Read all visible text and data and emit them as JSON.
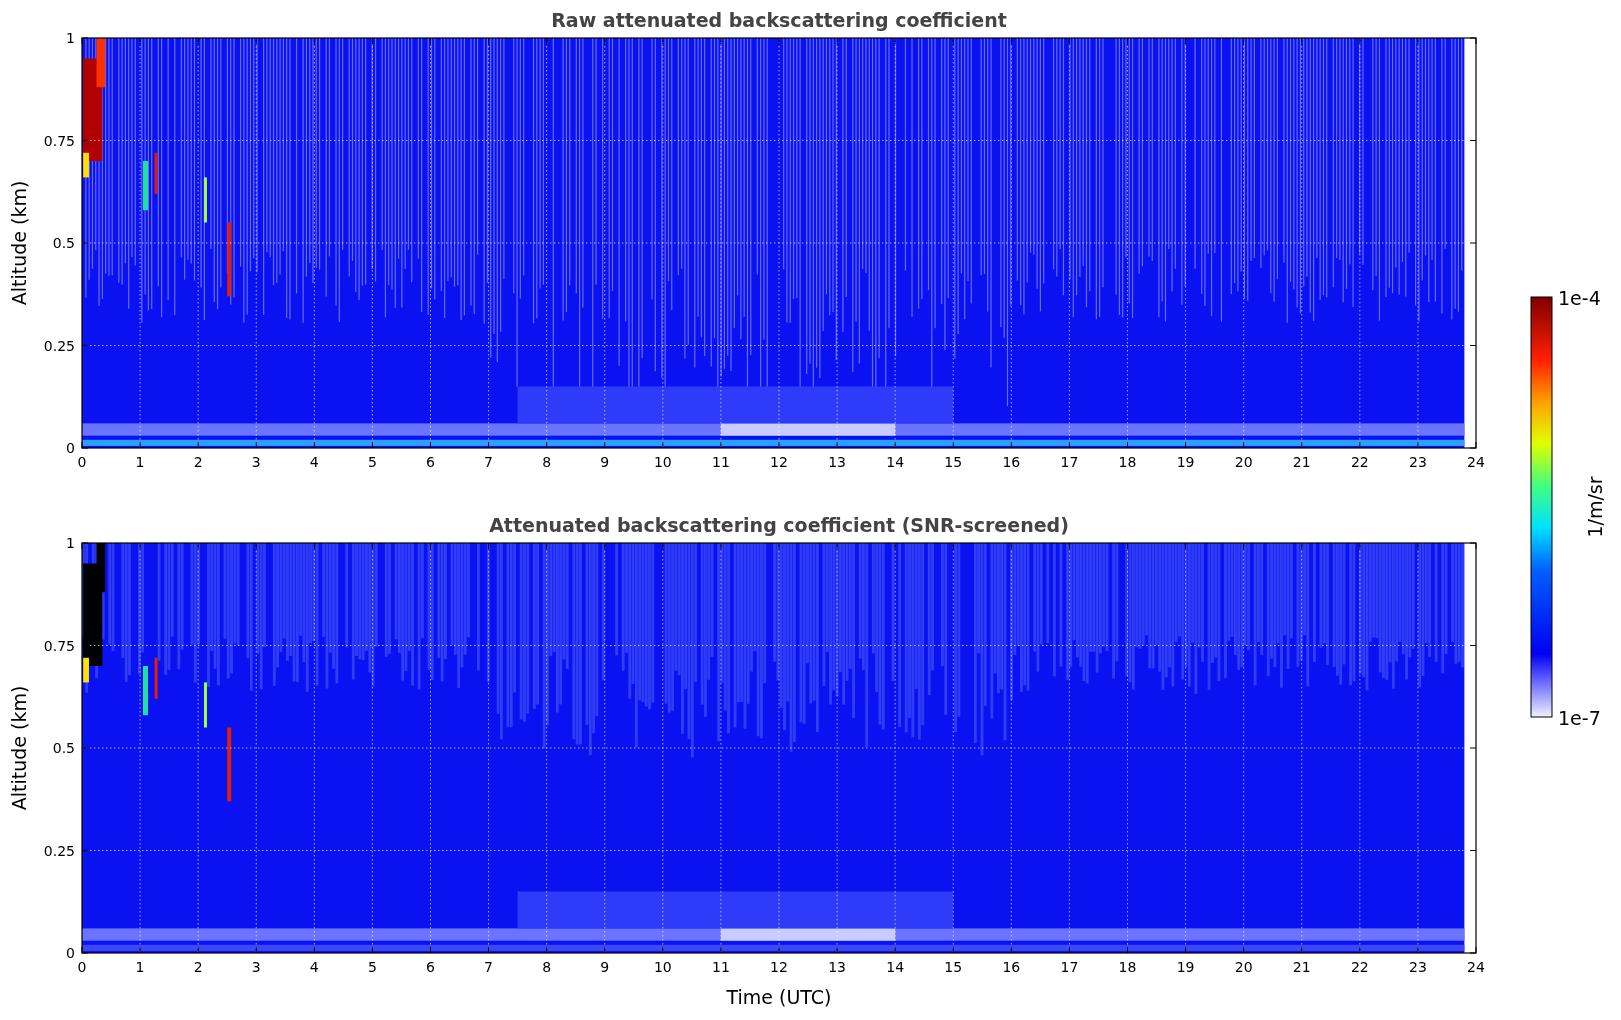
{
  "panels": [
    {
      "title": "Raw attenuated backscattering coefficient",
      "ylabel": "Altitude (km)",
      "yticks": [
        "1",
        "0.75",
        "0.5",
        "0.25",
        "0"
      ],
      "xticks": [
        "0",
        "1",
        "2",
        "3",
        "4",
        "5",
        "6",
        "7",
        "8",
        "9",
        "10",
        "11",
        "12",
        "13",
        "14",
        "15",
        "16",
        "17",
        "18",
        "19",
        "20",
        "21",
        "22",
        "23",
        "24"
      ]
    },
    {
      "title": "Attenuated backscattering coefficient (SNR-screened)",
      "ylabel": "Altitude (km)",
      "yticks": [
        "1",
        "0.75",
        "0.5",
        "0.25",
        "0"
      ],
      "xticks": [
        "0",
        "1",
        "2",
        "3",
        "4",
        "5",
        "6",
        "7",
        "8",
        "9",
        "10",
        "11",
        "12",
        "13",
        "14",
        "15",
        "16",
        "17",
        "18",
        "19",
        "20",
        "21",
        "22",
        "23",
        "24"
      ],
      "xlabel": "Time (UTC)"
    }
  ],
  "colorbar": {
    "label": "1/m/sr",
    "max": "1e-4",
    "min": "1e-7"
  }
}
